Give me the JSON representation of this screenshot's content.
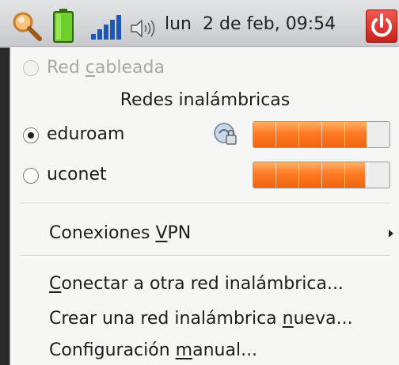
{
  "panel": {
    "clock": "lun  2 de feb, 09:54",
    "icons": [
      "search-icon",
      "battery-icon",
      "signal-icon",
      "volume-icon",
      "power-icon"
    ]
  },
  "menu": {
    "wired": {
      "label_pre": "Red ",
      "label_u": "c",
      "label_post": "ableada",
      "enabled": false
    },
    "wireless_header": "Redes inalámbricas",
    "networks": [
      {
        "name": "eduroam",
        "selected": true,
        "secure": true,
        "signal": 0.83
      },
      {
        "name": "uconet",
        "selected": false,
        "secure": false,
        "signal": 0.82
      }
    ],
    "vpn": {
      "label_pre": "Conexiones ",
      "label_u": "V",
      "label_post": "PN"
    },
    "connect_other": {
      "label_u": "C",
      "label_post": "onectar a otra red inalámbrica..."
    },
    "create_new": {
      "label_pre": "Crear una red inalámbrica ",
      "label_u": "n",
      "label_post": "ueva..."
    },
    "manual": {
      "label_pre": "Configuración ",
      "label_u": "m",
      "label_post": "anual..."
    }
  },
  "colors": {
    "bar_fill": "#ff7a22",
    "power": "#d3271f"
  }
}
